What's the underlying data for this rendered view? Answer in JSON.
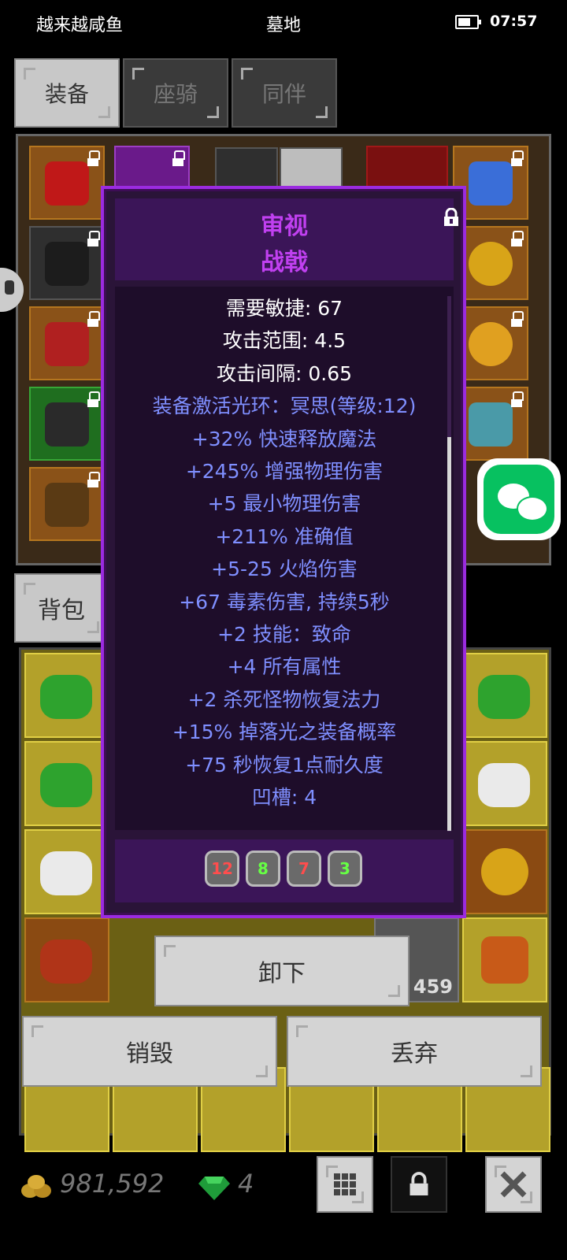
{
  "status_bar": {
    "app_name": "越来越咸鱼",
    "location": "墓地",
    "time": "07:57",
    "battery_level": 0.7
  },
  "tabs": [
    {
      "label": "装备",
      "active": true
    },
    {
      "label": "座骑",
      "active": false
    },
    {
      "label": "同伴",
      "active": false
    }
  ],
  "bag": {
    "label": "背包"
  },
  "tooltip": {
    "action": "审视",
    "item_name": "战戟",
    "lines": [
      {
        "text": "需要敏捷: 67",
        "color": "white"
      },
      {
        "text": "攻击范围: 4.5",
        "color": "white"
      },
      {
        "text": "攻击间隔: 0.65",
        "color": "white"
      },
      {
        "text": "装备激活光环：冥思(等级:12)",
        "color": "blue"
      },
      {
        "text": "+32% 快速释放魔法",
        "color": "blue"
      },
      {
        "text": "+245% 增强物理伤害",
        "color": "blue"
      },
      {
        "text": "+5 最小物理伤害",
        "color": "blue"
      },
      {
        "text": "+211% 准确值",
        "color": "blue"
      },
      {
        "text": "+5-25 火焰伤害",
        "color": "blue"
      },
      {
        "text": "+67 毒素伤害, 持续5秒",
        "color": "blue"
      },
      {
        "text": "+2 技能：致命",
        "color": "blue"
      },
      {
        "text": "+4 所有属性",
        "color": "blue"
      },
      {
        "text": "+2 杀死怪物恢复法力",
        "color": "blue"
      },
      {
        "text": "+15% 掉落光之装备概率",
        "color": "blue"
      },
      {
        "text": "+75 秒恢复1点耐久度",
        "color": "blue"
      },
      {
        "text": "凹槽: 4",
        "color": "blue"
      }
    ],
    "gems": [
      {
        "value": "12",
        "color": "#ff4d4d"
      },
      {
        "value": "8",
        "color": "#66ff44"
      },
      {
        "value": "7",
        "color": "#ff4d4d"
      },
      {
        "value": "3",
        "color": "#66ff44"
      }
    ]
  },
  "buttons": {
    "unequip": "卸下",
    "destroy": "销毁",
    "discard": "丢弃"
  },
  "stack_count": "459",
  "footer": {
    "gold": "981,592",
    "gems": "4"
  },
  "colors": {
    "tooltip_border": "#9b2be0",
    "title": "#c040f0",
    "stat_blue": "#7f8fff",
    "wechat": "#07c160"
  }
}
